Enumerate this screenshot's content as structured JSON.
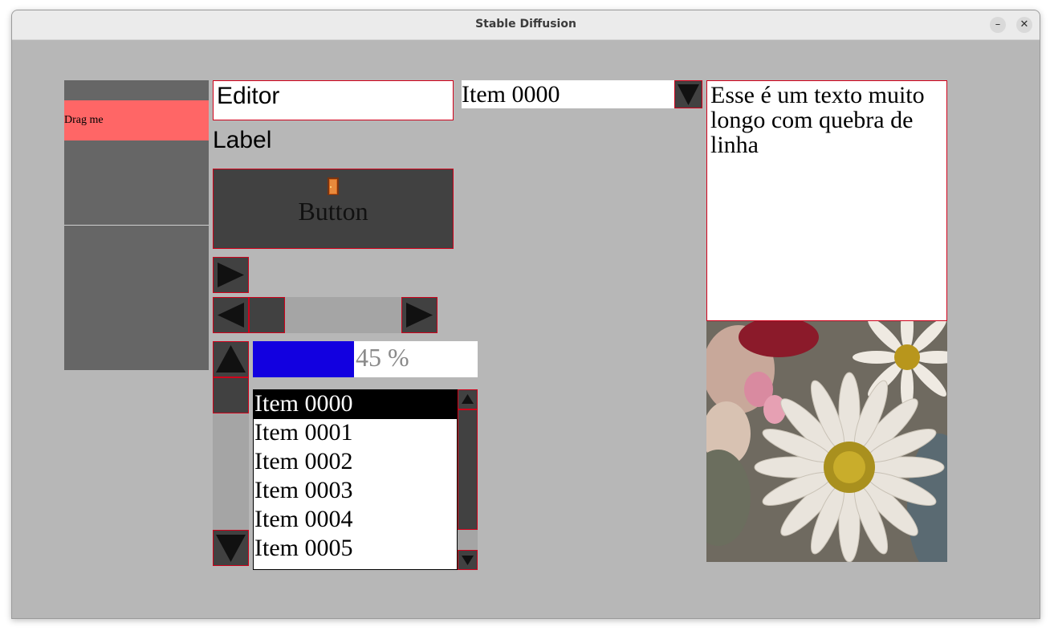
{
  "window": {
    "title": "Stable Diffusion",
    "minimize_icon": "minimize-icon",
    "close_icon": "close-icon"
  },
  "drag_panel": {
    "drag_label": "Drag me"
  },
  "editor": {
    "value": "Editor"
  },
  "label": {
    "text": "Label"
  },
  "button": {
    "label": "Button",
    "icon": "door-icon"
  },
  "combo": {
    "selected": "Item 0000",
    "arrow_icon": "triangle-down-icon"
  },
  "progress": {
    "value": 45,
    "text": "45 %",
    "fill_color": "#1200e0"
  },
  "horizontal_scrollbar": {
    "left_icon": "triangle-left-icon",
    "right_icon": "triangle-right-icon"
  },
  "vertical_scrollbar": {
    "up_icon": "triangle-up-icon",
    "down_icon": "triangle-down-icon"
  },
  "listbox": {
    "items": [
      "Item 0000",
      "Item 0001",
      "Item 0002",
      "Item 0003",
      "Item 0004",
      "Item 0005"
    ],
    "selected_index": 0
  },
  "textarea": {
    "value": "Esse é um texto muito longo com quebra de linha"
  },
  "image": {
    "subject": "flower-bouquet-image"
  },
  "colors": {
    "background": "#b7b7b7",
    "widget_dark": "#414141",
    "border": "#d0021b",
    "drag_highlight": "#ff6666",
    "panel": "#666666"
  }
}
